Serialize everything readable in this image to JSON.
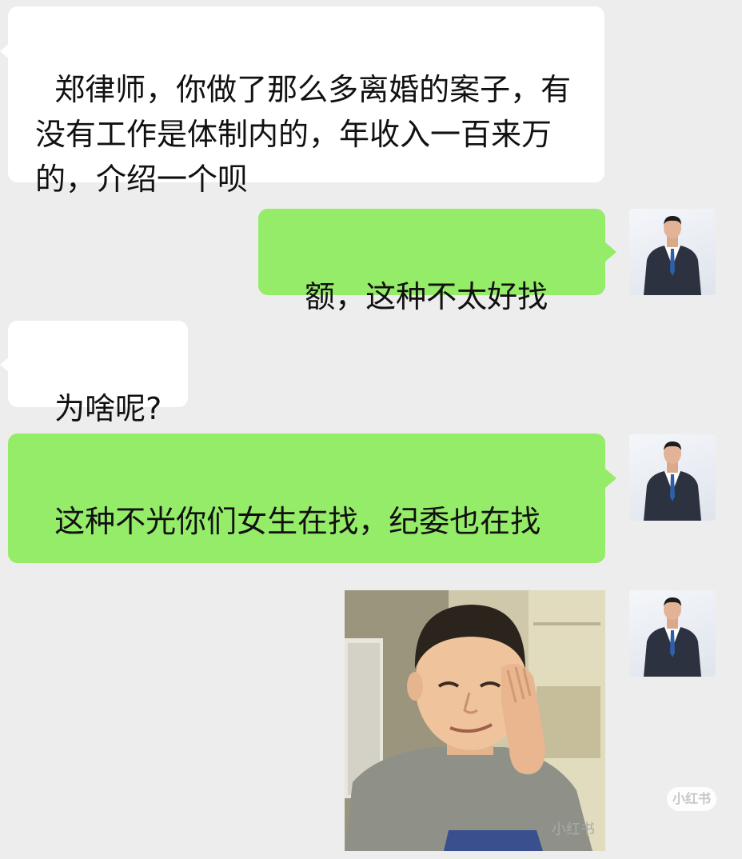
{
  "messages": [
    {
      "side": "in",
      "text": "郑律师，你做了那么多离婚的案子，有没有工作是体制内的，年收入一百来万的，介绍一个呗"
    },
    {
      "side": "out",
      "text": "额，这种不太好找"
    },
    {
      "side": "in",
      "text": "为啥呢?"
    },
    {
      "side": "out",
      "text": "这种不光你们女生在找，纪委也在找"
    },
    {
      "side": "out",
      "type": "image",
      "description_icon": "smug-man-photo"
    }
  ],
  "watermark": {
    "logo": "小红书",
    "text": "小红书"
  },
  "colors": {
    "background": "#ededed",
    "incoming_bubble": "#ffffff",
    "outgoing_bubble": "#95ec69"
  }
}
